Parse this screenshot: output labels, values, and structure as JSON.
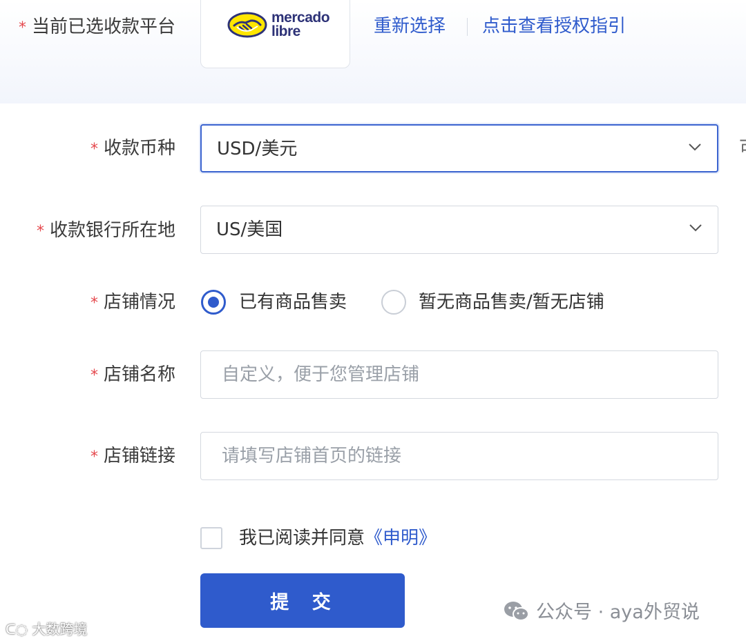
{
  "platform": {
    "label": "当前已选收款平台",
    "logo": {
      "line1": "mercado",
      "line2": "libre",
      "icon": "handshake-icon"
    },
    "reselect_link": "重新选择",
    "guide_link": "点击查看授权指引"
  },
  "form": {
    "required_mark": "*",
    "currency": {
      "label": "收款币种",
      "value": "USD/美元"
    },
    "bank_location": {
      "label": "收款银行所在地",
      "value": "US/美国"
    },
    "store_status": {
      "label": "店铺情况",
      "options": [
        {
          "label": "已有商品售卖",
          "checked": true
        },
        {
          "label": "暂无商品售卖/暂无店铺",
          "checked": false
        }
      ]
    },
    "store_name": {
      "label": "店铺名称",
      "placeholder": "自定义，便于您管理店铺"
    },
    "store_link": {
      "label": "店铺链接",
      "placeholder": "请填写店铺首页的链接"
    },
    "agreement": {
      "text": "我已阅读并同意",
      "link": "《申明》",
      "checked": false
    },
    "submit_label": "提 交"
  },
  "cut_text": "可",
  "watermarks": {
    "right": "公众号 · aya外贸说",
    "left": "大数跨境"
  },
  "colors": {
    "accent": "#2f5bcc",
    "required": "#e5484d",
    "border": "#d4d8df"
  }
}
